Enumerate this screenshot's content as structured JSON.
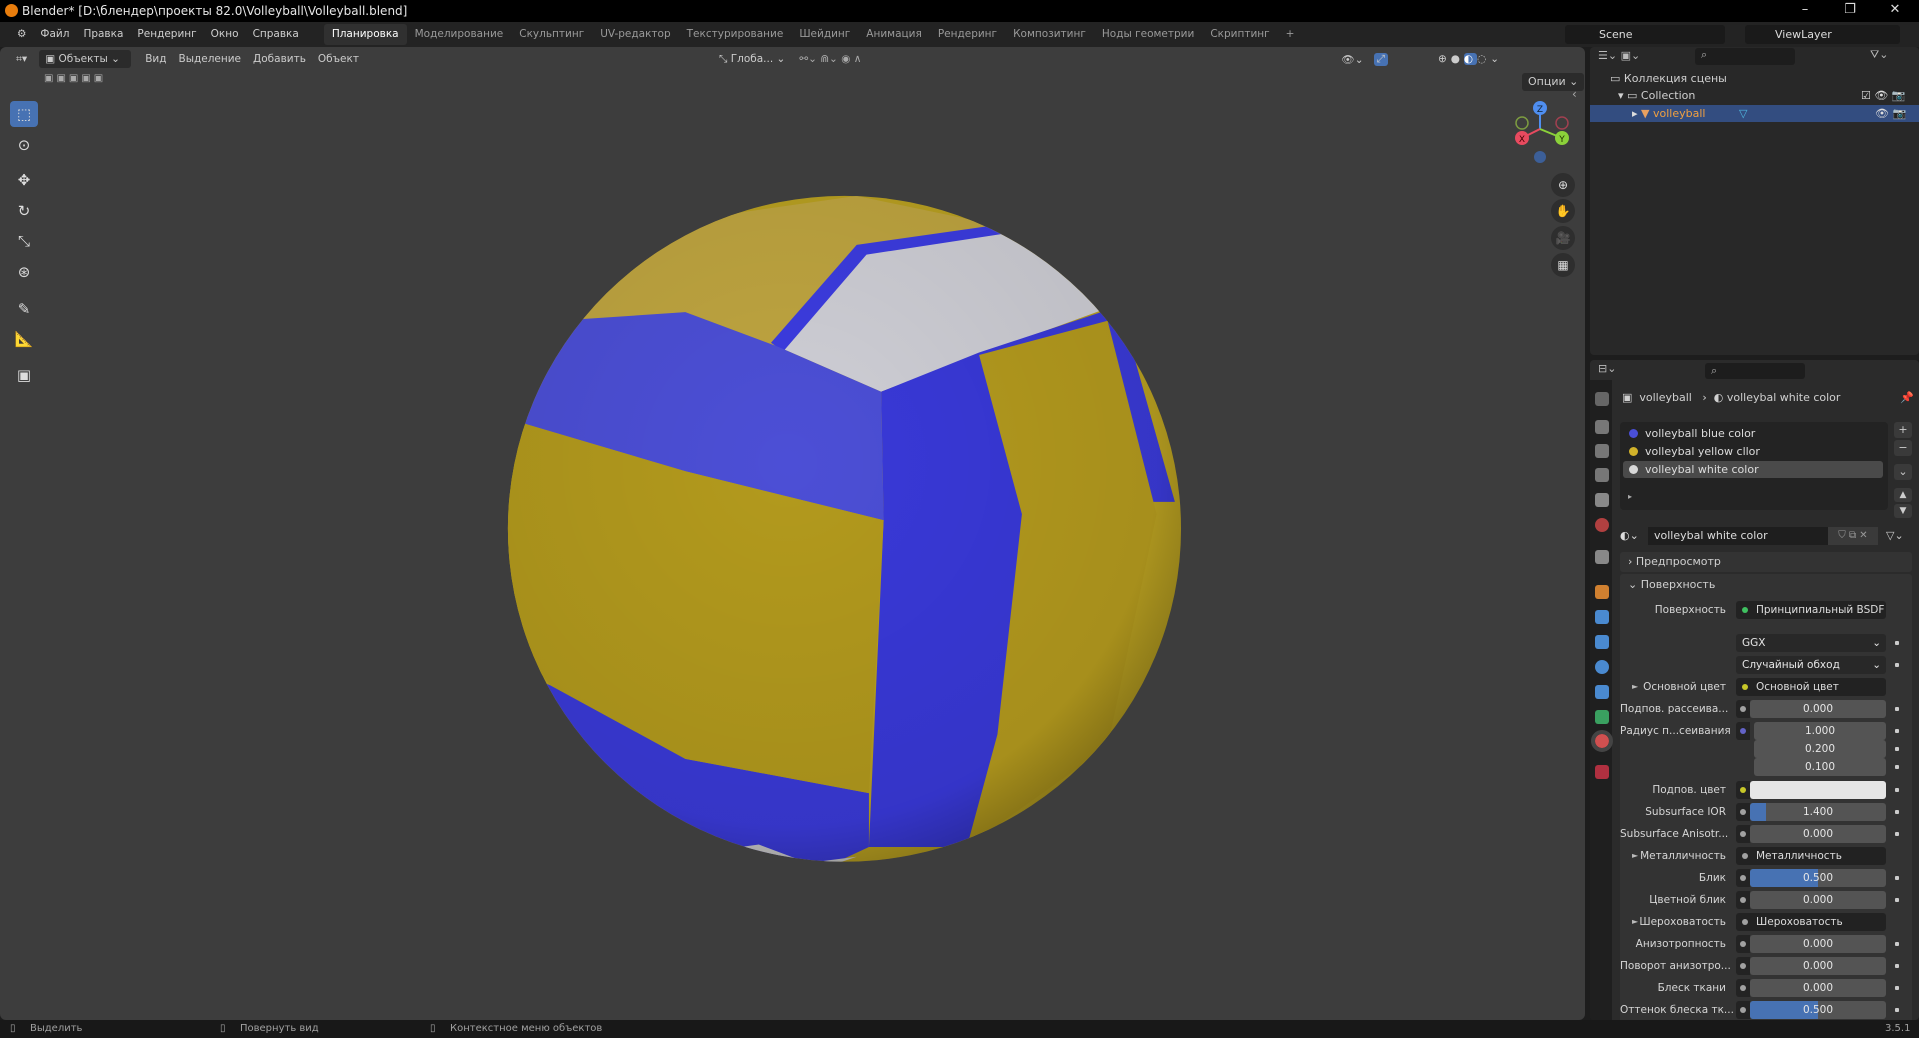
{
  "title": "Blender* [D:\\блендер\\проекты 82.0\\Volleyball\\Volleyball.blend]",
  "menu": [
    "Файл",
    "Правка",
    "Рендеринг",
    "Окно",
    "Справка"
  ],
  "workspaces": [
    "Планировка",
    "Моделирование",
    "Скульптинг",
    "UV-редактор",
    "Текстурирование",
    "Шейдинг",
    "Анимация",
    "Рендеринг",
    "Композитинг",
    "Ноды геометрии",
    "Скриптинг",
    "+"
  ],
  "scene": "Scene",
  "view_layer": "ViewLayer",
  "viewport": {
    "mode": "Объекты",
    "menus": [
      "Вид",
      "Выделение",
      "Добавить",
      "Объект"
    ],
    "orientation": "Глоба...",
    "options": "Опции",
    "gizmo": {
      "z": "Z",
      "x": "X",
      "y": "Y"
    }
  },
  "outliner": {
    "root": "Коллекция сцены",
    "collection": "Collection",
    "object": "volleyball"
  },
  "properties": {
    "breadcrumb_object": "volleyball",
    "breadcrumb_material": "volleybal white color",
    "materials": [
      {
        "name": "volleyball blue color",
        "color": "#4a4fd8"
      },
      {
        "name": "volleybal yellow cllor",
        "color": "#d1b22a"
      },
      {
        "name": "volleybal white color",
        "color": "#d8d8d8"
      }
    ],
    "active_material": "volleybal white color",
    "panel_preview": "Предпросмотр",
    "panel_surface": "Поверхность",
    "surface_label": "Поверхность",
    "surface_value": "Принципиальный BSDF",
    "distribution": "GGX",
    "subsurface_method": "Случайный обход",
    "rows": [
      {
        "label": "Основной цвет",
        "link": "Основной цвет",
        "expand": true,
        "sock": "#c7c729"
      },
      {
        "label": "Подпов. рассеива...",
        "value": "0.000",
        "sock": "#a1a1a1"
      },
      {
        "label": "Радиус п...сеивания",
        "value": "1.000",
        "sock": "#6363c7",
        "sub": true
      },
      {
        "label": "",
        "value": "0.200",
        "sub": true
      },
      {
        "label": "",
        "value": "0.100",
        "sub": true
      },
      {
        "label": "Подпов. цвет",
        "color": "#e6e6e6",
        "sock": "#c7c729"
      },
      {
        "label": "Subsurface IOR",
        "value": "1.400",
        "fill": 0.12,
        "sock": "#a1a1a1"
      },
      {
        "label": "Subsurface Anisotr...",
        "value": "0.000",
        "sock": "#a1a1a1"
      },
      {
        "label": "Металличность",
        "link": "Металличность",
        "expand": true,
        "sock": "#a1a1a1"
      },
      {
        "label": "Блик",
        "value": "0.500",
        "fill": 0.5,
        "sock": "#a1a1a1"
      },
      {
        "label": "Цветной блик",
        "value": "0.000",
        "sock": "#a1a1a1"
      },
      {
        "label": "Шероховатость",
        "link": "Шероховатость",
        "expand": true,
        "sock": "#a1a1a1"
      },
      {
        "label": "Анизотропность",
        "value": "0.000",
        "sock": "#a1a1a1"
      },
      {
        "label": "Поворот анизотро...",
        "value": "0.000",
        "sock": "#a1a1a1"
      },
      {
        "label": "Блеск ткани",
        "value": "0.000",
        "sock": "#a1a1a1"
      },
      {
        "label": "Оттенок блеска тк...",
        "value": "0.500",
        "fill": 0.5,
        "sock": "#a1a1a1"
      }
    ]
  },
  "status": {
    "select": "Выделить",
    "rotate": "Повернуть вид",
    "context": "Контекстное меню объектов",
    "version": "3.5.1"
  }
}
